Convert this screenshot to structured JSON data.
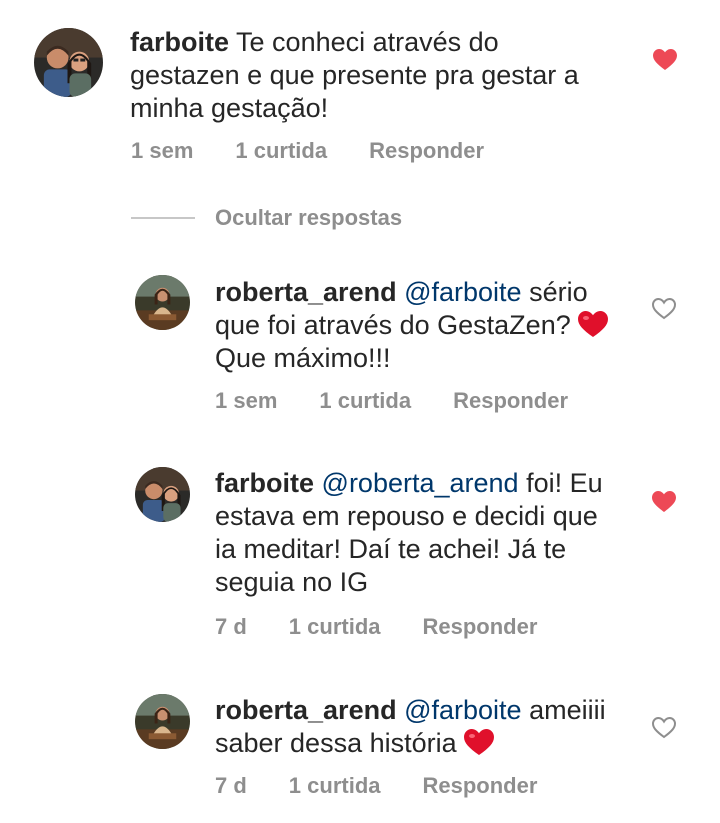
{
  "colors": {
    "liked_heart": "#ed4956",
    "mention": "#00376b",
    "meta_text": "#8e8e8e",
    "emoji_heart": "#e0102b"
  },
  "hide_replies_label": "Ocultar respostas",
  "comments": [
    {
      "username": "farboite",
      "text_parts": [
        "Te conheci através do",
        "gestazen e que presente pra gestar a",
        "minha gestação!"
      ],
      "time": "1 sem",
      "likes": "1 curtida",
      "reply": "Responder",
      "liked": true
    },
    {
      "username": "roberta_arend",
      "mention": "@farboite",
      "line1_after_mention": "sério",
      "line2": "que foi através do GestaZen?",
      "line3": "Que máximo!!!",
      "time": "1 sem",
      "likes": "1 curtida",
      "reply": "Responder",
      "liked": false
    },
    {
      "username": "farboite",
      "mention": "@roberta_arend",
      "line1_after_mention": "foi! Eu",
      "line2": "estava em repouso e decidi que",
      "line3": "ia meditar! Daí te achei! Já te",
      "line4": "seguia no IG",
      "time": "7 d",
      "likes": "1 curtida",
      "reply": "Responder",
      "liked": true
    },
    {
      "username": "roberta_arend",
      "mention": "@farboite",
      "line1_after_mention": "ameiiii",
      "line2": "saber dessa história",
      "time": "7 d",
      "likes": "1 curtida",
      "reply": "Responder",
      "liked": false
    }
  ]
}
